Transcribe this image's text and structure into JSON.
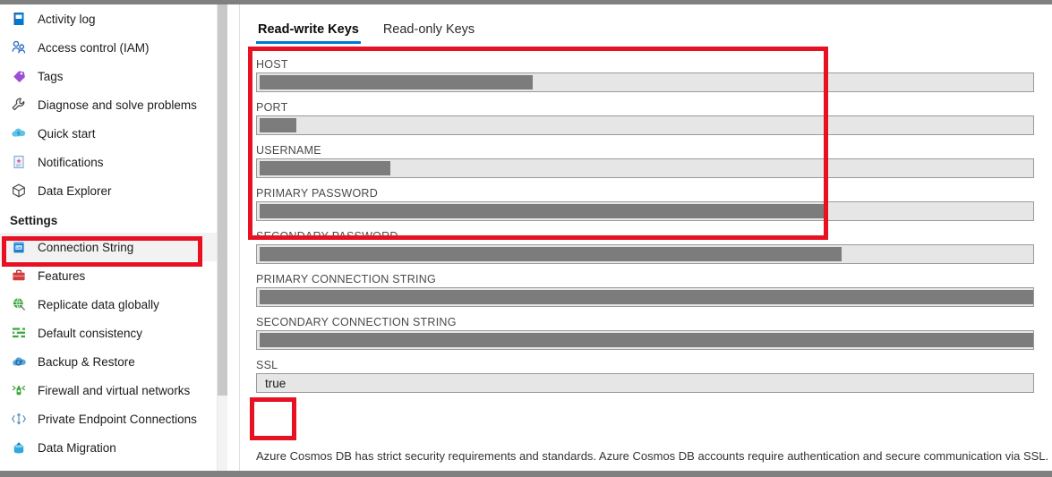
{
  "sidebar": {
    "items": [
      {
        "label": "Activity log",
        "icon": "activity-log-icon",
        "selected": false
      },
      {
        "label": "Access control (IAM)",
        "icon": "access-control-icon",
        "selected": false
      },
      {
        "label": "Tags",
        "icon": "tags-icon",
        "selected": false
      },
      {
        "label": "Diagnose and solve problems",
        "icon": "wrench-icon",
        "selected": false
      },
      {
        "label": "Quick start",
        "icon": "quick-start-icon",
        "selected": false
      },
      {
        "label": "Notifications",
        "icon": "notifications-icon",
        "selected": false
      },
      {
        "label": "Data Explorer",
        "icon": "data-explorer-icon",
        "selected": false
      }
    ],
    "section_label": "Settings",
    "settings_items": [
      {
        "label": "Connection String",
        "icon": "connection-string-icon",
        "selected": true
      },
      {
        "label": "Features",
        "icon": "features-icon",
        "selected": false
      },
      {
        "label": "Replicate data globally",
        "icon": "replicate-globally-icon",
        "selected": false
      },
      {
        "label": "Default consistency",
        "icon": "default-consistency-icon",
        "selected": false
      },
      {
        "label": "Backup & Restore",
        "icon": "backup-restore-icon",
        "selected": false
      },
      {
        "label": "Firewall and virtual networks",
        "icon": "firewall-icon",
        "selected": false
      },
      {
        "label": "Private Endpoint Connections",
        "icon": "private-endpoint-icon",
        "selected": false
      },
      {
        "label": "Data Migration",
        "icon": "data-migration-icon",
        "selected": false
      }
    ]
  },
  "main": {
    "tabs": [
      {
        "label": "Read-write Keys",
        "active": true
      },
      {
        "label": "Read-only Keys",
        "active": false
      }
    ],
    "fields": [
      {
        "label": "HOST",
        "value": "",
        "redacted": true,
        "redact_width": 305
      },
      {
        "label": "PORT",
        "value": "",
        "redacted": true,
        "redact_width": 41
      },
      {
        "label": "USERNAME",
        "value": "",
        "redacted": true,
        "redact_width": 146
      },
      {
        "label": "PRIMARY PASSWORD",
        "value": "",
        "redacted": true,
        "redact_width": 631
      },
      {
        "label": "SECONDARY PASSWORD",
        "value": "",
        "redacted": true,
        "redact_width": 650
      },
      {
        "label": "PRIMARY CONNECTION STRING",
        "value": "",
        "redacted": true,
        "redact_width": 884
      },
      {
        "label": "SECONDARY CONNECTION STRING",
        "value": "",
        "redacted": true,
        "redact_width": 884
      },
      {
        "label": "SSL",
        "value": "true",
        "redacted": false,
        "redact_width": 0
      }
    ],
    "note": "Azure Cosmos DB has strict security requirements and standards. Azure Cosmos DB accounts require authentication and secure communication via SSL."
  },
  "annotations": {
    "color": "#e81123",
    "boxes": [
      {
        "name": "fields-highlight"
      },
      {
        "name": "ssl-highlight"
      },
      {
        "name": "connection-string-nav-highlight"
      }
    ]
  },
  "colors": {
    "accent": "#0078d4",
    "annotation_red": "#e81123",
    "field_bg": "#e6e6e6",
    "redaction_gray": "#7c7c7c",
    "selected_nav_bg": "#f2f2f2"
  }
}
